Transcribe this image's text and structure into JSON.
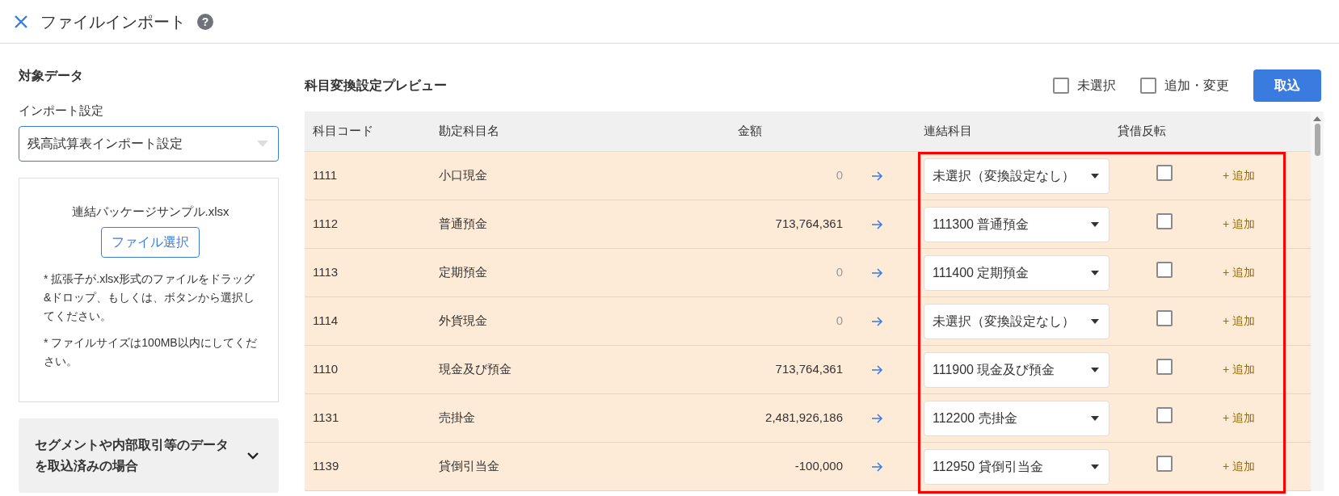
{
  "header": {
    "title": "ファイルインポート",
    "help_icon": "?"
  },
  "sidebar": {
    "section_title": "対象データ",
    "import_label": "インポート設定",
    "import_setting": "残高試算表インポート設定",
    "file_name": "連結パッケージサンプル.xlsx",
    "file_button": "ファイル選択",
    "notes": [
      "* 拡張子が.xlsx形式のファイルをドラッグ&ドロップ、もしくは、ボタンから選択してください。",
      "* ファイルサイズは100MB以内にしてください。"
    ],
    "accordion": {
      "title": "セグメントや内部取引等のデータを取込済みの場合",
      "expanded": false
    }
  },
  "preview": {
    "title": "科目変換設定プレビュー",
    "filters": [
      {
        "label": "未選択",
        "checked": false
      },
      {
        "label": "追加・変更",
        "checked": false
      }
    ],
    "import_button": "取込",
    "columns": [
      "科目コード",
      "勘定科目名",
      "金額",
      "連結科目",
      "貸借反転"
    ],
    "rows": [
      {
        "code": "1111",
        "name": "小口現金",
        "amount": "0",
        "dimmed": true,
        "mapping": "未選択（変換設定なし）",
        "reverse": false,
        "add": "+ 追加"
      },
      {
        "code": "1112",
        "name": "普通預金",
        "amount": "713,764,361",
        "dimmed": false,
        "mapping": "111300 普通預金",
        "reverse": false,
        "add": "+ 追加"
      },
      {
        "code": "1113",
        "name": "定期預金",
        "amount": "0",
        "dimmed": true,
        "mapping": "111400 定期預金",
        "reverse": false,
        "add": "+ 追加"
      },
      {
        "code": "1114",
        "name": "外貨現金",
        "amount": "0",
        "dimmed": true,
        "mapping": "未選択（変換設定なし）",
        "reverse": false,
        "add": "+ 追加"
      },
      {
        "code": "1110",
        "name": "現金及び預金",
        "amount": "713,764,361",
        "dimmed": false,
        "mapping": "111900 現金及び預金",
        "reverse": false,
        "add": "+ 追加"
      },
      {
        "code": "1131",
        "name": "売掛金",
        "amount": "2,481,926,186",
        "dimmed": false,
        "mapping": "112200 売掛金",
        "reverse": false,
        "add": "+ 追加"
      },
      {
        "code": "1139",
        "name": "貸倒引当金",
        "amount": "-100,000",
        "dimmed": false,
        "mapping": "112950 貸倒引当金",
        "reverse": false,
        "add": "+ 追加"
      }
    ]
  }
}
